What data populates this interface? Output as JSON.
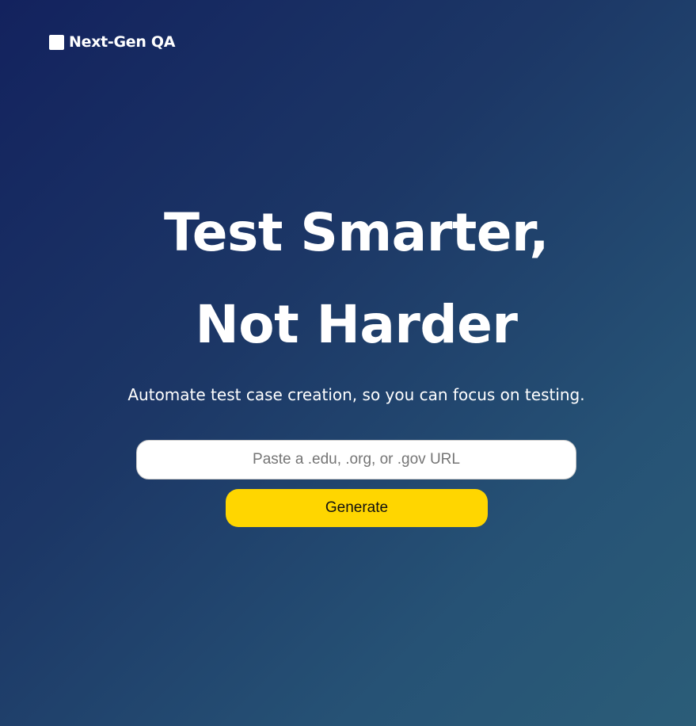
{
  "header": {
    "brand_name": "Next-Gen QA",
    "brand_icon": "square-logo-icon"
  },
  "hero": {
    "title_line1": "Test Smarter,",
    "title_line2": "Not Harder",
    "subtitle": "Automate test case creation, so you can focus on testing."
  },
  "form": {
    "url_value": "",
    "url_placeholder": "Paste a .edu, .org, or .gov URL",
    "generate_label": "Generate"
  },
  "colors": {
    "background_start": "#13225e",
    "background_end": "#2b5d78",
    "button": "#ffd600",
    "text": "#ffffff"
  }
}
